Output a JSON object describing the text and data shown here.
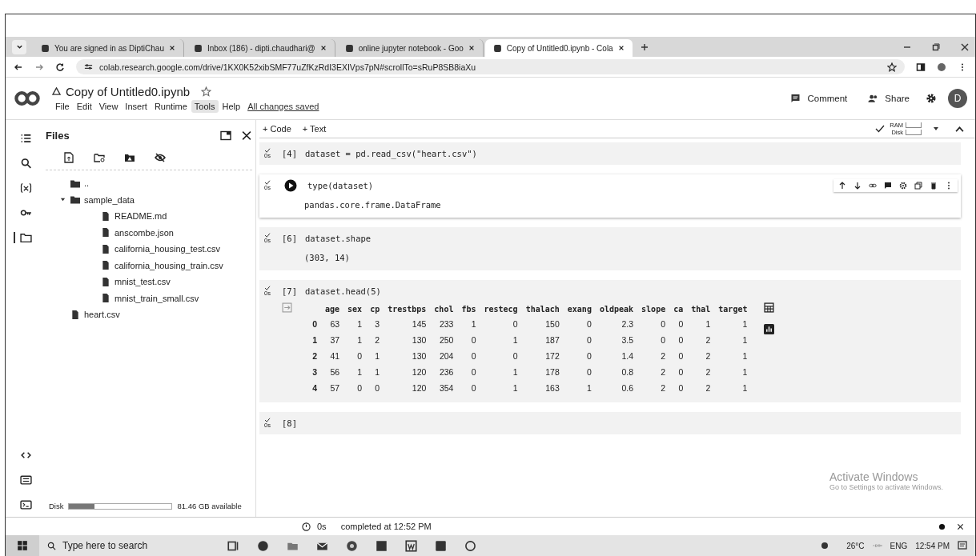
{
  "browser": {
    "tabs": [
      {
        "title": "You are signed in as DiptiChau",
        "selected": false
      },
      {
        "title": "Inbox (186) - dipti.chaudhari@",
        "selected": false
      },
      {
        "title": "online jupyter notebook - Goo",
        "selected": false
      },
      {
        "title": "Copy of Untitled0.ipynb - Cola",
        "selected": true
      }
    ],
    "url": "colab.research.google.com/drive/1KX0K52xibSMF77uZfKzRdI3EXIVps7pN#scrollTo=sRuP8SB8iaXu"
  },
  "notebook": {
    "title": "Copy of Untitled0.ipynb",
    "menu": [
      {
        "label": "File",
        "selected": false
      },
      {
        "label": "Edit",
        "selected": false
      },
      {
        "label": "View",
        "selected": false
      },
      {
        "label": "Insert",
        "selected": false
      },
      {
        "label": "Runtime",
        "selected": false
      },
      {
        "label": "Tools",
        "selected": true
      },
      {
        "label": "Help",
        "selected": false
      }
    ],
    "save_status": "All changes saved",
    "comment": "Comment",
    "share": "Share",
    "avatar": "D"
  },
  "toolbar": {
    "add_code": "+ Code",
    "add_text": "+ Text",
    "ram": "RAM",
    "disk": "Disk"
  },
  "sidebar": {
    "title": "Files",
    "tree": [
      {
        "name": "..",
        "kind": "parent"
      },
      {
        "name": "sample_data",
        "kind": "folder",
        "expanded": true,
        "children": [
          {
            "name": "README.md",
            "kind": "file"
          },
          {
            "name": "anscombe.json",
            "kind": "file"
          },
          {
            "name": "california_housing_test.csv",
            "kind": "file"
          },
          {
            "name": "california_housing_train.csv",
            "kind": "file"
          },
          {
            "name": "mnist_test.csv",
            "kind": "file"
          },
          {
            "name": "mnist_train_small.csv",
            "kind": "file"
          }
        ]
      },
      {
        "name": "heart.csv",
        "kind": "file"
      }
    ],
    "disk": {
      "label": "Disk",
      "level": 0.25,
      "free": "81.46 GB available"
    }
  },
  "cells": [
    {
      "prompt": "[4]",
      "time": "0s",
      "selected": false,
      "code": "dataset = pd.read_csv(\"heart.csv\")"
    },
    {
      "time": "0s",
      "selected": true,
      "code": "type(dataset)",
      "output": {
        "kind": "text",
        "text": "pandas.core.frame.DataFrame"
      }
    },
    {
      "prompt": "[6]",
      "time": "0s",
      "selected": false,
      "code": "dataset.shape",
      "output": {
        "kind": "text",
        "text": "(303, 14)"
      }
    },
    {
      "prompt": "[7]",
      "time": "0s",
      "selected": false,
      "code": "dataset.head(5)",
      "output": {
        "kind": "table",
        "columns": [
          "",
          "age",
          "sex",
          "cp",
          "trestbps",
          "chol",
          "fbs",
          "restecg",
          "thalach",
          "exang",
          "oldpeak",
          "slope",
          "ca",
          "thal",
          "target"
        ],
        "rows": [
          [
            "0",
            "63",
            "1",
            "3",
            "145",
            "233",
            "1",
            "0",
            "150",
            "0",
            "2.3",
            "0",
            "0",
            "1",
            "1"
          ],
          [
            "1",
            "37",
            "1",
            "2",
            "130",
            "250",
            "0",
            "1",
            "187",
            "0",
            "3.5",
            "0",
            "0",
            "2",
            "1"
          ],
          [
            "2",
            "41",
            "0",
            "1",
            "130",
            "204",
            "0",
            "0",
            "172",
            "0",
            "1.4",
            "2",
            "0",
            "2",
            "1"
          ],
          [
            "3",
            "56",
            "1",
            "1",
            "120",
            "236",
            "0",
            "1",
            "178",
            "0",
            "0.8",
            "2",
            "0",
            "2",
            "1"
          ],
          [
            "4",
            "57",
            "0",
            "0",
            "120",
            "354",
            "0",
            "1",
            "163",
            "1",
            "0.6",
            "2",
            "0",
            "2",
            "1"
          ]
        ]
      }
    },
    {
      "prompt": "[8]",
      "time": "0s",
      "selected": false
    }
  ],
  "status_bar": {
    "time": "0s",
    "text": "completed at 12:52 PM"
  },
  "activation": {
    "title": "Activate Windows",
    "text": "Go to Settings to activate Windows."
  },
  "taskbar": {
    "search": "Type here to search",
    "temperature": "26°C",
    "language": "ENG",
    "clock": "12:54 PM"
  }
}
